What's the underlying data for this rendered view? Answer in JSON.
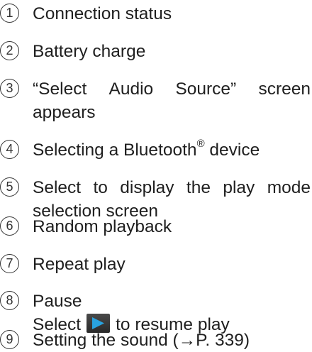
{
  "items": [
    {
      "number": "1",
      "text": "Connection status"
    },
    {
      "number": "2",
      "text": "Battery charge"
    },
    {
      "number": "3",
      "words": [
        "“Select",
        "Audio",
        "Source”",
        "screen"
      ],
      "line2": "appears"
    },
    {
      "number": "4",
      "text": "Selecting a Bluetooth",
      "sup": "®",
      "text_after": " device"
    },
    {
      "number": "5",
      "words": [
        "Select",
        "to",
        "display",
        "the",
        "play",
        "mode"
      ],
      "line2": "selection screen"
    },
    {
      "number": "6",
      "text": "Random playback"
    },
    {
      "number": "7",
      "text": "Repeat play"
    },
    {
      "number": "8",
      "text": "Pause",
      "line2_before": "Select",
      "line2_after": "to resume play",
      "icon": "play-icon"
    },
    {
      "number": "9",
      "text": "Setting the sound (→P. 339)"
    }
  ],
  "colors": {
    "text": "#1f1f1f",
    "icon_bg": "#3a3a3a",
    "icon_arrow": "#29a3e0"
  }
}
